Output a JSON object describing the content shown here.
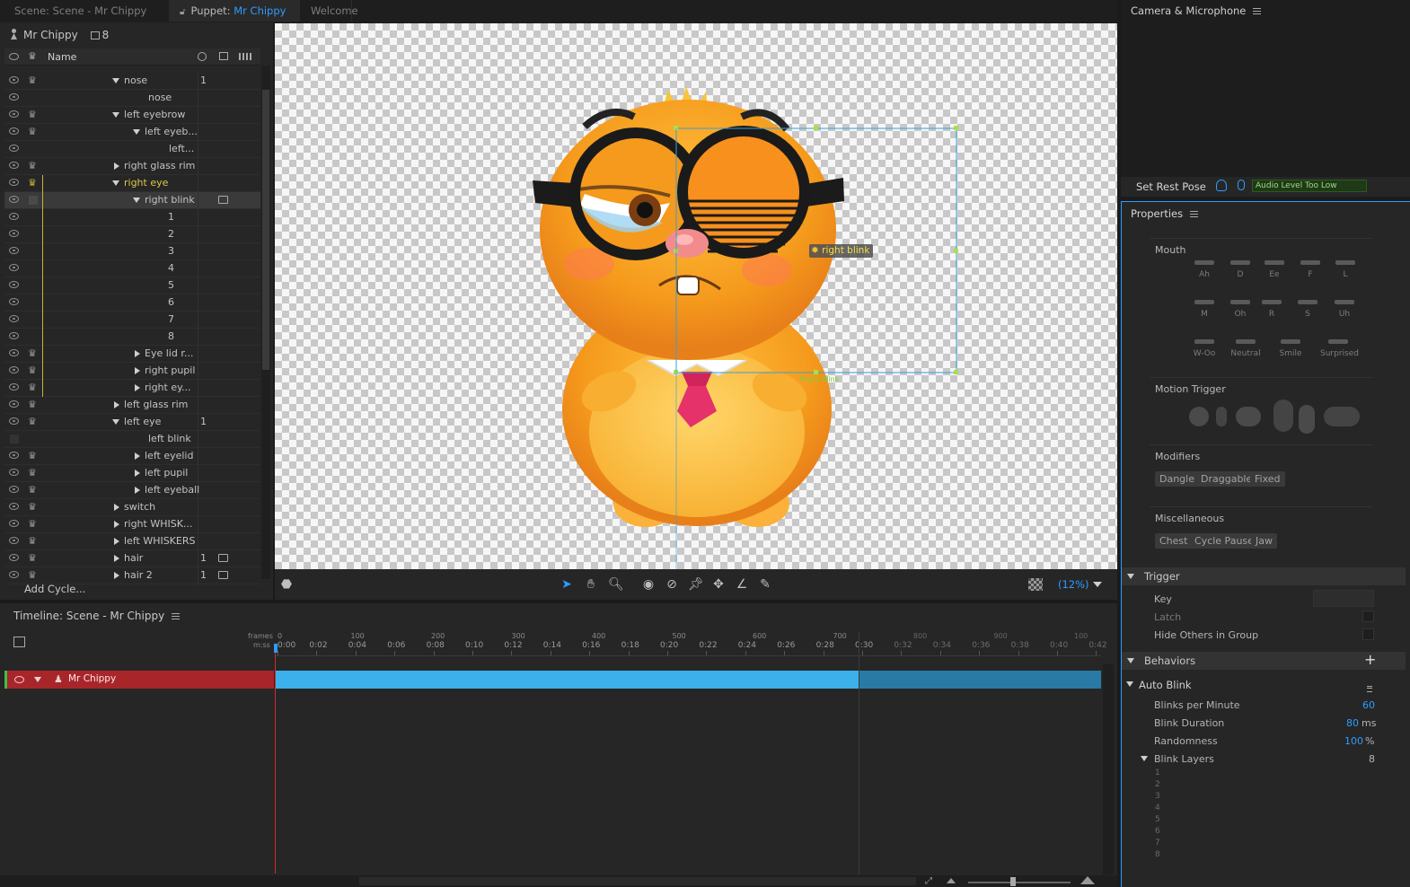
{
  "tabs": [
    {
      "label": "Scene: Scene - Mr Chippy",
      "prefix": "",
      "highlight": ""
    },
    {
      "label": "Puppet: ",
      "highlight": "Mr Chippy"
    },
    {
      "label": "Welcome"
    }
  ],
  "camera_panel": {
    "title": "Camera & Microphone",
    "set_rest_pose": "Set Rest Pose",
    "audio_status": "Audio Level Too Low"
  },
  "puppet_panel": {
    "puppet_name": "Mr Chippy",
    "layer_count": "8",
    "name_header": "Name",
    "add_cycle": "Add Cycle...",
    "rows": [
      {
        "name": "nose",
        "num": "1"
      },
      {
        "name": "nose",
        "num": ""
      },
      {
        "name": "left eyebrow",
        "num": ""
      },
      {
        "name": "left eyeb...",
        "num": ""
      },
      {
        "name": "left...",
        "num": ""
      },
      {
        "name": "right glass rim",
        "num": ""
      },
      {
        "name": "right eye",
        "num": ""
      },
      {
        "name": "right blink",
        "num": ""
      },
      {
        "name": "1",
        "num": ""
      },
      {
        "name": "2",
        "num": ""
      },
      {
        "name": "3",
        "num": ""
      },
      {
        "name": "4",
        "num": ""
      },
      {
        "name": "5",
        "num": ""
      },
      {
        "name": "6",
        "num": ""
      },
      {
        "name": "7",
        "num": ""
      },
      {
        "name": "8",
        "num": ""
      },
      {
        "name": "Eye lid r...",
        "num": ""
      },
      {
        "name": "right pupil",
        "num": ""
      },
      {
        "name": "right ey...",
        "num": ""
      },
      {
        "name": "left glass rim",
        "num": ""
      },
      {
        "name": "left eye",
        "num": "1"
      },
      {
        "name": "left blink",
        "num": ""
      },
      {
        "name": "left eyelid",
        "num": ""
      },
      {
        "name": "left pupil",
        "num": ""
      },
      {
        "name": "left eyeball",
        "num": ""
      },
      {
        "name": "switch",
        "num": ""
      },
      {
        "name": "right WHISK...",
        "num": ""
      },
      {
        "name": "left WHISKERS",
        "num": ""
      },
      {
        "name": "hair",
        "num": "1"
      },
      {
        "name": "hair 2",
        "num": "1"
      }
    ]
  },
  "canvas": {
    "handle_label": "right blink",
    "tag_label": "Right Blink",
    "zoom": "(12%)"
  },
  "timeline": {
    "title": "Timeline: Scene - Mr Chippy",
    "frames_label": "frames",
    "mss_label": "m:ss",
    "frame_ticks": [
      "0",
      "100",
      "200",
      "300",
      "400",
      "500",
      "600",
      "700",
      "800",
      "900",
      "100"
    ],
    "time_ticks": [
      "0:00",
      "0:02",
      "0:04",
      "0:06",
      "0:08",
      "0:10",
      "0:12",
      "0:14",
      "0:16",
      "0:18",
      "0:20",
      "0:22",
      "0:24",
      "0:26",
      "0:28",
      "0:30",
      "0:32",
      "0:34",
      "0:36",
      "0:38",
      "0:40",
      "0:42"
    ],
    "track_name": "Mr Chippy"
  },
  "properties": {
    "title": "Properties",
    "mouth_label": "Mouth",
    "visemes": [
      "Ah",
      "D",
      "Ee",
      "F",
      "L",
      "M",
      "Oh",
      "R",
      "S",
      "Uh",
      "W-Oo",
      "Neutral",
      "Smile",
      "Surprised"
    ],
    "motion_trigger": "Motion Trigger",
    "modifiers_label": "Modifiers",
    "modifiers": [
      "Dangle",
      "Draggable",
      "Fixed"
    ],
    "misc_label": "Miscellaneous",
    "misc": [
      "Chest",
      "Cycle Pause",
      "Jaw"
    ],
    "trigger_section": "Trigger",
    "trigger_key": "Key",
    "trigger_latch": "Latch",
    "trigger_hide": "Hide Others in Group",
    "behaviors_section": "Behaviors",
    "auto_blink": "Auto Blink",
    "blinks_per_minute_label": "Blinks per Minute",
    "blinks_per_minute": "60",
    "blink_duration_label": "Blink Duration",
    "blink_duration": "80",
    "blink_duration_unit": "ms",
    "randomness_label": "Randomness",
    "randomness": "100",
    "randomness_unit": "%",
    "blink_layers_label": "Blink Layers",
    "blink_layers": "8",
    "blink_layer_list": [
      "1",
      "2",
      "3",
      "4",
      "5",
      "6",
      "7",
      "8"
    ]
  },
  "colors": {
    "accent": "#2d9cff",
    "track": "#a8262a",
    "bar": "#3cb0ea",
    "hamster": "#f59a1c"
  }
}
